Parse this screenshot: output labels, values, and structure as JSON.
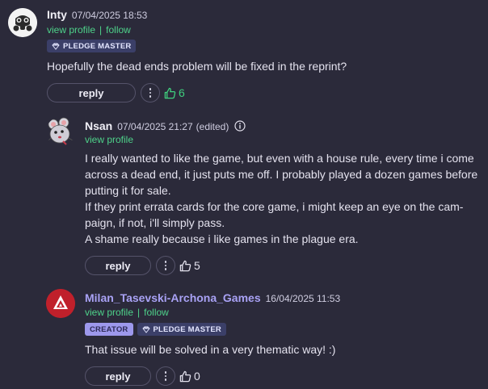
{
  "comments": [
    {
      "username": "Inty",
      "date": "07/04/2025 18:53",
      "view_profile": "view profile",
      "separator": "|",
      "follow": "follow",
      "badges": [
        "PLEDGE MASTER"
      ],
      "body": [
        "Hopefully the dead ends problem will be fixed in the reprint?"
      ],
      "reply_label": "reply",
      "likes": "6",
      "avatar_icon": "gasmask-avatar",
      "like_icon": "thumbs-up-icon"
    },
    {
      "username": "Nsan",
      "date": "07/04/2025 21:27",
      "edited": "(edited)",
      "view_profile": "view profile",
      "body": [
        "I really wanted to like the game, but even with a house rule, every time i come",
        "across a dead end, it just puts me off. I probably played a dozen games before",
        "putting it for sale.",
        "If they print errata cards for the core game, i might keep an eye on the cam-",
        "paign, if not, i'll simply pass.",
        "A shame really because i like games in the plague era."
      ],
      "reply_label": "reply",
      "likes": "5",
      "avatar_icon": "rat-avatar",
      "like_icon": "thumbs-up-icon"
    },
    {
      "username": "Milan_Tasevski-Archona_Games",
      "date": "16/04/2025 11:53",
      "view_profile": "view profile",
      "separator": "|",
      "follow": "follow",
      "badges": [
        "CREATOR",
        "PLEDGE MASTER"
      ],
      "body": [
        "That issue will be solved in a very thematic way! :)"
      ],
      "reply_label": "reply",
      "likes": "0",
      "avatar_icon": "archona-logo-avatar",
      "like_icon": "thumbs-up-icon"
    }
  ],
  "colors": {
    "background": "#2b2a3a",
    "link_green": "#4ed28a",
    "creator_badge": "#9d98ec",
    "pledge_badge": "#3b3f68",
    "username_link": "#a9a2f5"
  }
}
